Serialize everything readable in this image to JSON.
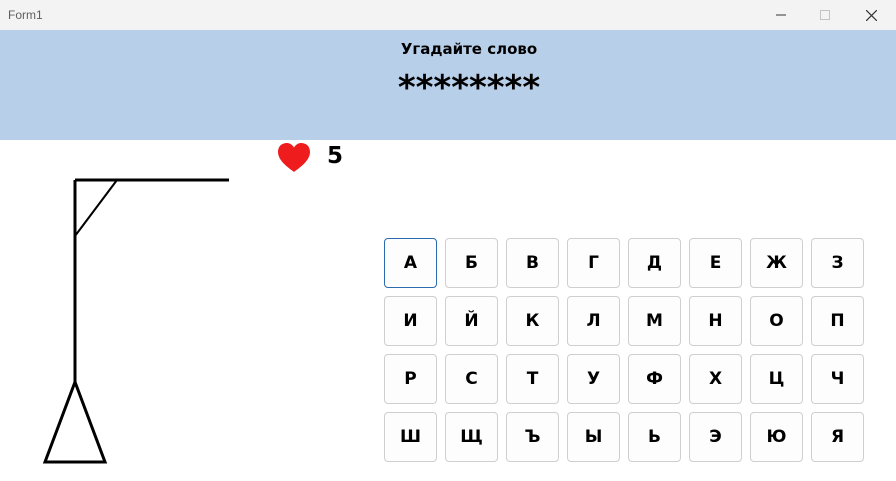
{
  "window": {
    "title": "Form1"
  },
  "header": {
    "prompt": "Угадайте слово",
    "masked_word": "********"
  },
  "lives": {
    "count": "5",
    "icon": "heart-icon",
    "color": "#ee1c1c"
  },
  "keyboard": {
    "letters": [
      "А",
      "Б",
      "В",
      "Г",
      "Д",
      "Е",
      "Ж",
      "З",
      "И",
      "Й",
      "К",
      "Л",
      "М",
      "Н",
      "О",
      "П",
      "Р",
      "С",
      "Т",
      "У",
      "Ф",
      "Х",
      "Ц",
      "Ч",
      "Ш",
      "Щ",
      "Ъ",
      "Ы",
      "Ь",
      "Э",
      "Ю",
      "Я"
    ],
    "focused_index": 0
  },
  "colors": {
    "header_bg": "#b8cfe9",
    "titlebar_bg": "#f3f3f3"
  }
}
